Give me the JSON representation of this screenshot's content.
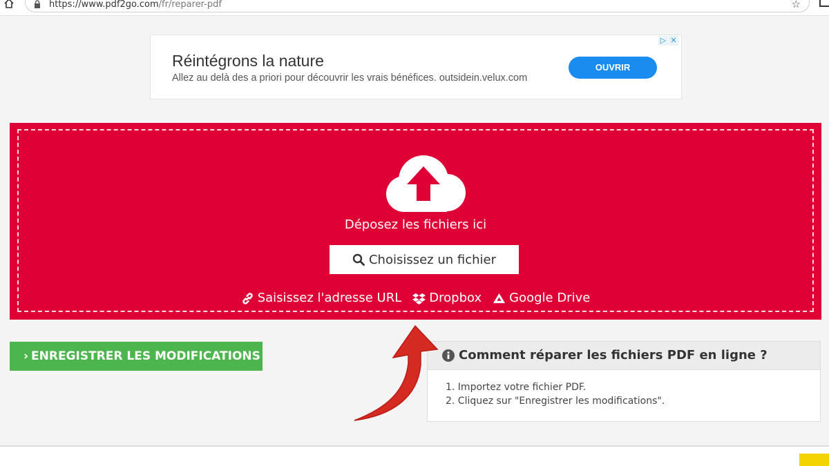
{
  "browser": {
    "url_base": "https://www.pdf2go.com",
    "url_path": "/fr/reparer-pdf",
    "star_glyph": "☆"
  },
  "ad": {
    "title": "Réintégrons la nature",
    "text": "Allez au delà des a priori pour découvrir les vrais bénéfices. outsidein.velux.com",
    "button_label": "OUVRIR",
    "adchoices_icon": "▷",
    "close_icon": "✕",
    "button_color": "#1a8cf0"
  },
  "dropzone": {
    "drop_text": "Déposez les fichiers ici",
    "choose_label": "Choisissez un fichier",
    "sources": {
      "url": "Saisissez l'adresse URL",
      "dropbox": "Dropbox",
      "drive": "Google Drive"
    },
    "color": "#df0036"
  },
  "actions": {
    "save_chevron": "›",
    "save_label": "ENREGISTRER LES MODIFICATIONS",
    "save_color": "#4db54d"
  },
  "howto": {
    "title": "Comment réparer les fichiers PDF en ligne ?",
    "steps": [
      "1. Importez votre fichier PDF.",
      "2. Cliquez sur \"Enregistrer les modifications\"."
    ]
  }
}
